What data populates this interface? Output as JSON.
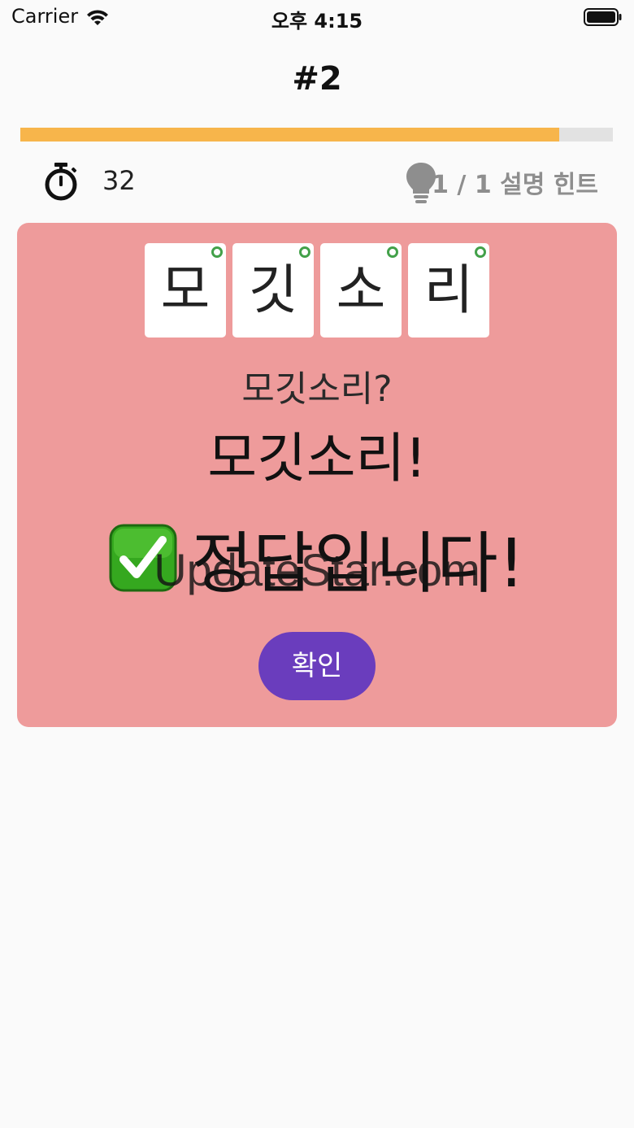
{
  "status_bar": {
    "carrier": "Carrier",
    "time": "오후 4:15",
    "wifi_icon": "wifi-icon",
    "battery_icon": "battery-icon"
  },
  "header": {
    "title": "#2",
    "progress_fraction": 0.91
  },
  "info": {
    "timer_icon": "stopwatch-icon",
    "timer_value": "32",
    "hint_icon": "lightbulb-icon",
    "hint_text": "1 / 1 설명 힌트"
  },
  "card": {
    "tiles": [
      {
        "char": "모",
        "status": "correct"
      },
      {
        "char": "깃",
        "status": "correct"
      },
      {
        "char": "소",
        "status": "correct"
      },
      {
        "char": "리",
        "status": "correct"
      }
    ],
    "guess": "모깃소리?",
    "answer": "모깃소리!",
    "result_icon": "check-mark-icon",
    "result_text": "정답입니다!",
    "confirm_label": "확인"
  },
  "watermark": "UpdateStar.com",
  "colors": {
    "background": "#fafafa",
    "progress_fill": "#f7b54b",
    "progress_track": "#e2e2e2",
    "card_bg": "#ee9b9b",
    "correct_dot": "#43a14a",
    "button_bg": "#6a3dbd",
    "hint_text": "#8e8e8e"
  }
}
